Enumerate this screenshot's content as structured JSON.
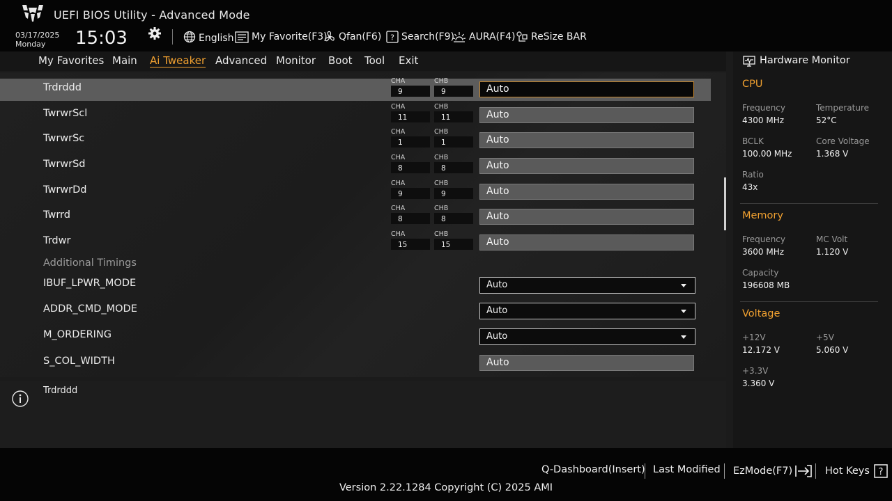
{
  "app": {
    "title": "UEFI BIOS Utility - Advanced Mode",
    "logo_icon": "tuf-logo-icon"
  },
  "datetime": {
    "date": "03/17/2025",
    "day": "Monday",
    "time": "15:03"
  },
  "toolbar": {
    "language": "English",
    "favorite": "My Favorite(F3)",
    "qfan": "Qfan(F6)",
    "search": "Search(F9)",
    "aura": "AURA(F4)",
    "resize_bar": "ReSize BAR"
  },
  "tabs": [
    {
      "label": "My Favorites"
    },
    {
      "label": "Main"
    },
    {
      "label": "Ai Tweaker",
      "active": true
    },
    {
      "label": "Advanced"
    },
    {
      "label": "Monitor"
    },
    {
      "label": "Boot"
    },
    {
      "label": "Tool"
    },
    {
      "label": "Exit"
    }
  ],
  "timing_rows": [
    {
      "label": "Trdrddd",
      "cha": "9",
      "chb": "9",
      "value": "Auto",
      "selected": true
    },
    {
      "label": "TwrwrScl",
      "cha": "11",
      "chb": "11",
      "value": "Auto"
    },
    {
      "label": "TwrwrSc",
      "cha": "1",
      "chb": "1",
      "value": "Auto"
    },
    {
      "label": "TwrwrSd",
      "cha": "8",
      "chb": "8",
      "value": "Auto"
    },
    {
      "label": "TwrwrDd",
      "cha": "9",
      "chb": "9",
      "value": "Auto"
    },
    {
      "label": "Twrrd",
      "cha": "8",
      "chb": "8",
      "value": "Auto"
    },
    {
      "label": "Trdwr",
      "cha": "15",
      "chb": "15",
      "value": "Auto"
    }
  ],
  "channel_labels": {
    "a": "CHA",
    "b": "CHB"
  },
  "section_additional": "Additional Timings",
  "additional_rows": [
    {
      "label": "IBUF_LPWR_MODE",
      "value": "Auto",
      "type": "dropdown"
    },
    {
      "label": "ADDR_CMD_MODE",
      "value": "Auto",
      "type": "dropdown"
    },
    {
      "label": "M_ORDERING",
      "value": "Auto",
      "type": "dropdown"
    },
    {
      "label": "S_COL_WIDTH",
      "value": "Auto",
      "type": "text"
    }
  ],
  "info": {
    "text": "Trdrddd"
  },
  "hardware_monitor": {
    "title": "Hardware Monitor",
    "cpu": {
      "title": "CPU",
      "frequency_label": "Frequency",
      "frequency": "4300 MHz",
      "temperature_label": "Temperature",
      "temperature": "52°C",
      "bclk_label": "BCLK",
      "bclk": "100.00 MHz",
      "core_voltage_label": "Core Voltage",
      "core_voltage": "1.368 V",
      "ratio_label": "Ratio",
      "ratio": "43x"
    },
    "memory": {
      "title": "Memory",
      "frequency_label": "Frequency",
      "frequency": "3600 MHz",
      "mc_volt_label": "MC Volt",
      "mc_volt": "1.120 V",
      "capacity_label": "Capacity",
      "capacity": "196608 MB"
    },
    "voltage": {
      "title": "Voltage",
      "v12_label": "+12V",
      "v12": "12.172 V",
      "v5_label": "+5V",
      "v5": "5.060 V",
      "v33_label": "+3.3V",
      "v33": "3.360 V"
    }
  },
  "footer": {
    "qdashboard": "Q-Dashboard(Insert)",
    "last_modified": "Last Modified",
    "ezmode": "EzMode(F7)",
    "hotkeys": "Hot Keys",
    "version": "Version 2.22.1284 Copyright (C) 2025 AMI"
  },
  "colors": {
    "accent": "#f0a030",
    "selected_row": "#5c5c5c",
    "background": "#1b1b1b"
  }
}
